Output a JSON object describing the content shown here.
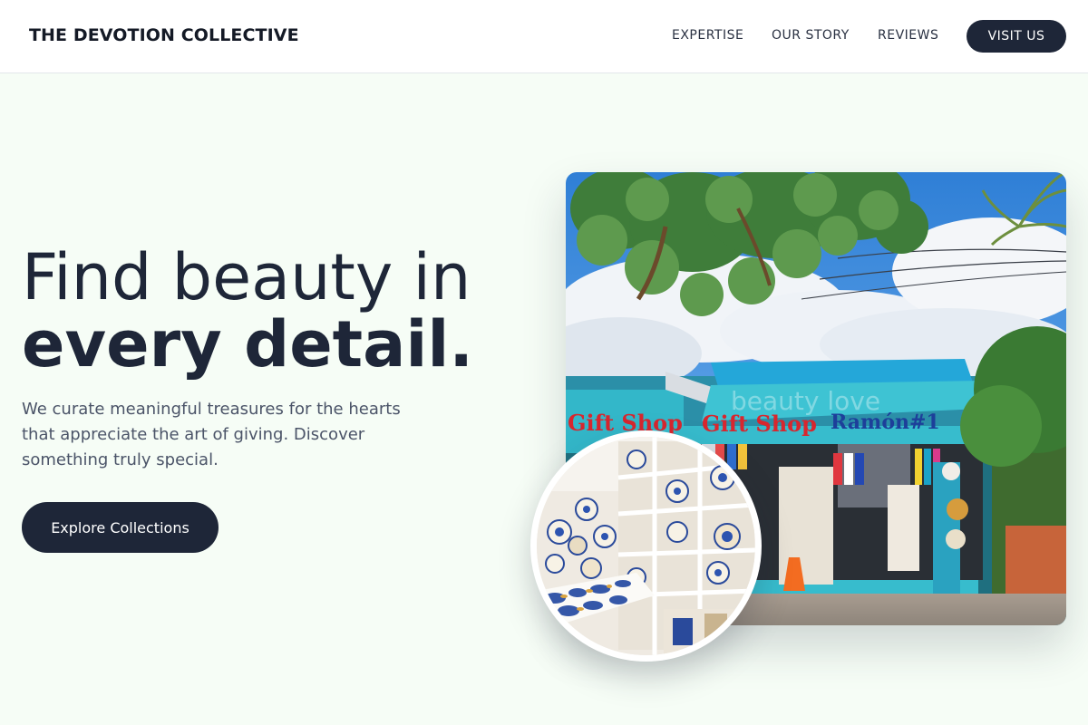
{
  "header": {
    "brand": "THE DEVOTION COLLECTIVE",
    "nav": {
      "expertise": "EXPERTISE",
      "our_story": "OUR STORY",
      "reviews": "REVIEWS"
    },
    "visit_button": "VISIT US"
  },
  "hero": {
    "headline_line1": "Find beauty in",
    "headline_line2": "every detail.",
    "description": "We curate meaningful treasures for the hearts that appreciate the art of giving. Discover something truly special.",
    "cta_label": "Explore Collections"
  },
  "images": {
    "main_photo": {
      "sign_left": "Gift Shop",
      "sign_center": "Gift Shop",
      "sign_right": "Ramón#1",
      "watermark": "beauty love"
    }
  },
  "colors": {
    "page_background": "#f6fdf6",
    "primary_dark": "#1e2638",
    "body_text": "#4b5468",
    "header_background": "#ffffff"
  }
}
